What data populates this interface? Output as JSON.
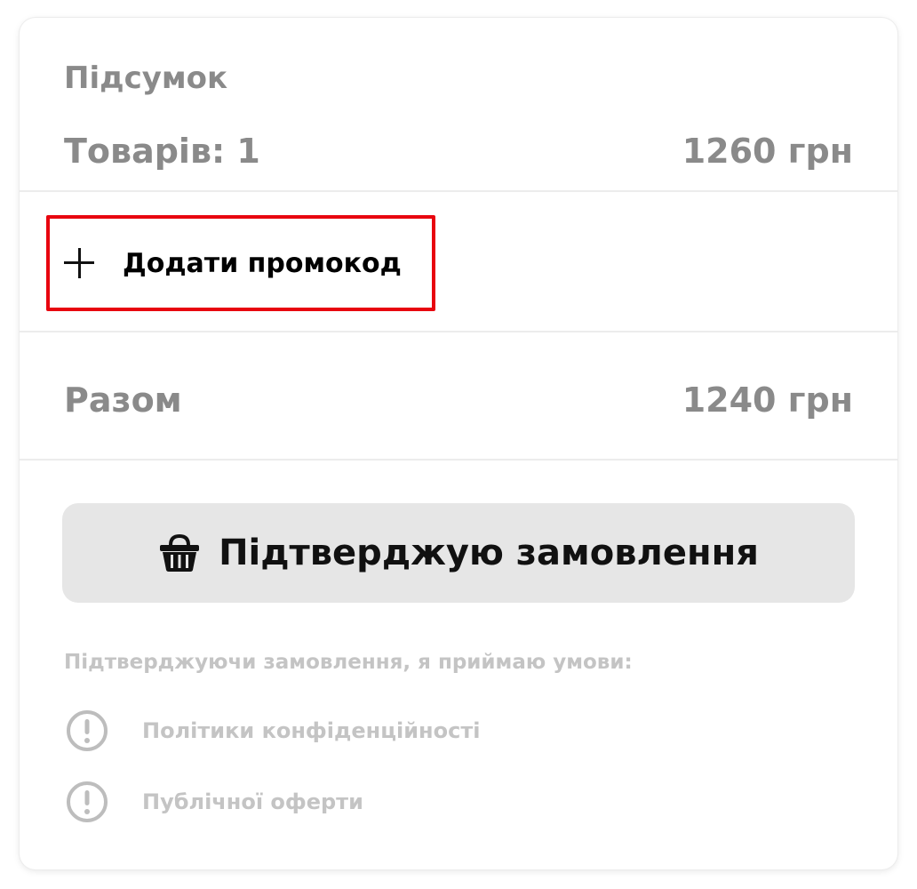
{
  "summary": {
    "title": "Підсумок",
    "goods_label": "Товарів: 1",
    "goods_price": "1260 грн"
  },
  "promo": {
    "label": "Додати промокод",
    "highlight_color": "#e8050f"
  },
  "total": {
    "label": "Разом",
    "price": "1240 грн"
  },
  "confirm": {
    "label": "Підтверджую замовлення",
    "icon": "basket-icon"
  },
  "terms": {
    "intro": "Підтверджуючи замовлення, я приймаю умови:",
    "items": [
      {
        "label": "Політики конфіденційності",
        "icon": "alert-circle-icon"
      },
      {
        "label": "Публічної оферти",
        "icon": "alert-circle-icon"
      }
    ]
  },
  "colors": {
    "muted_text": "#8a8a8a",
    "faint_text": "#c4c4c4",
    "button_bg": "#e6e6e6"
  }
}
